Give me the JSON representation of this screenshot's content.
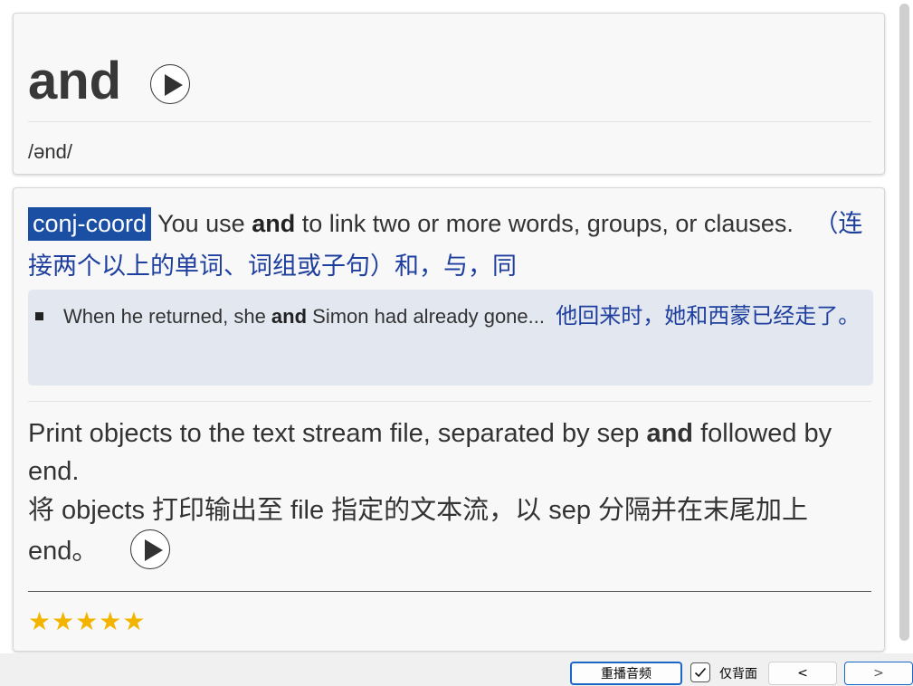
{
  "header_card": {
    "word": "and",
    "phonetic": "/ənd/"
  },
  "definition": {
    "pos_tag": "conj-coord",
    "text_before": "You use ",
    "keyword": "and",
    "text_after": " to link two or more words, groups, or clauses.",
    "translation": "（连接两个以上的单词、词组或子句）和，与，同"
  },
  "example": {
    "text_before": "When he returned, she ",
    "keyword": "and",
    "text_after": " Simon had already gone...",
    "translation": "他回来时，她和西蒙已经走了。"
  },
  "note": {
    "text_before": "Print objects to the text stream file, separated by sep ",
    "keyword": "and",
    "text_after": " followed by end.",
    "translation": "将 objects 打印输出至 file 指定的文本流，以 sep 分隔并在末尾加上 end。"
  },
  "rating": {
    "stars": 5,
    "display": "★★★★★"
  },
  "toolbar": {
    "replay_label": "重播音频",
    "back_only_label": "仅背面",
    "back_only_checked": true,
    "prev_label": "<",
    "next_label": ">"
  },
  "colors": {
    "pos_tag_bg": "#1a4fa3",
    "translation_blue": "#1e3f9e",
    "star_gold": "#f3b400",
    "focus_border": "#1a67c7"
  },
  "icons": {
    "play": "play-icon",
    "check": "check-icon",
    "bullet": "bullet-icon"
  }
}
